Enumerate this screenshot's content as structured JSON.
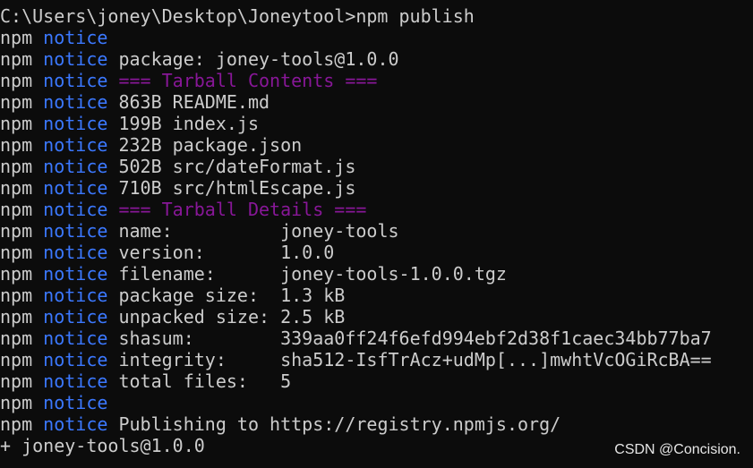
{
  "prompt_command": "C:\\Users\\joney\\Desktop\\Joneytool>npm publish",
  "prefix": "npm",
  "notice_word": "notice",
  "lines": [
    {
      "kind": "empty",
      "text": ""
    },
    {
      "kind": "text",
      "text": "package: joney-tools@1.0.0"
    },
    {
      "kind": "heading",
      "text": "=== Tarball Contents ==="
    },
    {
      "kind": "text",
      "text": "863B README.md"
    },
    {
      "kind": "text",
      "text": "199B index.js"
    },
    {
      "kind": "text",
      "text": "232B package.json"
    },
    {
      "kind": "text",
      "text": "502B src/dateFormat.js"
    },
    {
      "kind": "text",
      "text": "710B src/htmlEscape.js"
    },
    {
      "kind": "heading",
      "text": "=== Tarball Details ==="
    },
    {
      "kind": "text",
      "text": "name:          joney-tools"
    },
    {
      "kind": "text",
      "text": "version:       1.0.0"
    },
    {
      "kind": "text",
      "text": "filename:      joney-tools-1.0.0.tgz"
    },
    {
      "kind": "text",
      "text": "package size:  1.3 kB"
    },
    {
      "kind": "text",
      "text": "unpacked size: 2.5 kB"
    },
    {
      "kind": "text",
      "text": "shasum:        339aa0ff24f6efd994ebf2d38f1caec34bb77ba7"
    },
    {
      "kind": "text",
      "text": "integrity:     sha512-IsfTrAcz+udMp[...]mwhtVcOGiRcBA=="
    },
    {
      "kind": "text",
      "text": "total files:   5"
    },
    {
      "kind": "empty",
      "text": ""
    },
    {
      "kind": "text",
      "text": "Publishing to https://registry.npmjs.org/"
    }
  ],
  "result_line": "+ joney-tools@1.0.0",
  "watermark": "CSDN @Concision.",
  "colors": {
    "background": "#0c0c0c",
    "foreground": "#cccccc",
    "notice": "#3b78ff",
    "heading": "#881798"
  }
}
